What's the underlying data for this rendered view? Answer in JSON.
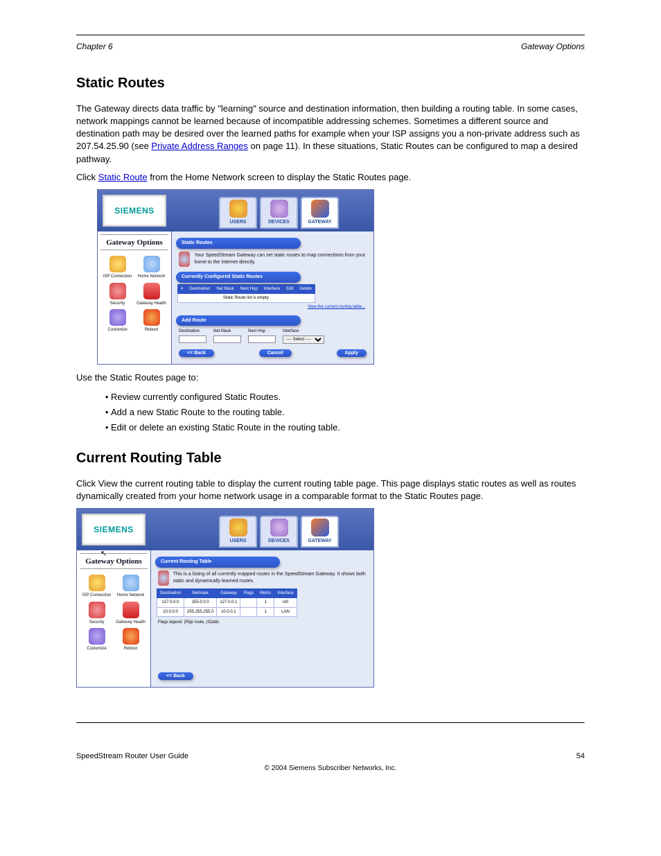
{
  "header": {
    "chapter": "Chapter 6",
    "section": "Gateway Options"
  },
  "body": {
    "h1_static": "Static Routes",
    "p1a": "The Gateway directs data traffic by \"learning\" source and destination information, then building a routing table. In some cases, network mappings cannot be learned because of incompatible addressing schemes. Sometimes a different source and destination path may be desired over the learned paths for example when your ISP assigns you a non-private address such as 207.54.25.90 (see ",
    "p1_link_text": "Private Address Ranges",
    "p1b": " on page 11). In these situations, Static Routes can be configured to map a desired pathway.",
    "p2a": "Click ",
    "p2_link_text": "Static Route",
    "p2b": " from the Home Network screen to display the Static Routes page.",
    "sr_intro": "Use the Static Routes page to:",
    "sr_bullets": [
      "Review currently configured Static Routes.",
      "Add a new Static Route to the routing table.",
      "Edit or delete an existing Static Route in the routing table."
    ],
    "h1_current": "Current Routing Table",
    "cr_p": "Click View the current routing table to display the current routing table page. This page displays static routes as well as routes dynamically created from your home network usage in a comparable format to the Static Routes page."
  },
  "shot_common": {
    "brand": "SIEMENS",
    "tabs": [
      "USERS",
      "DEVICES",
      "GATEWAY"
    ],
    "sidebar_title": "Gateway Options",
    "sidebar_items": [
      {
        "label": "ISP Connection"
      },
      {
        "label": "Home Network"
      },
      {
        "label": "Security"
      },
      {
        "label": "Gateway Health"
      },
      {
        "label": "Customize"
      },
      {
        "label": "Reboot"
      }
    ]
  },
  "shot1": {
    "pill_static": "Static Routes",
    "desc": "Your SpeedStream Gateway can set static routes to map connections from your home to the Internet directly.",
    "pill_current": "Currently Configured Static Routes",
    "th": [
      "#",
      "Destination",
      "Net Mask",
      "Next Hop",
      "Interface",
      "Edit",
      "Delete"
    ],
    "empty_msg": "Static Route list is empty.",
    "link_view": "View the current routing table...",
    "pill_add": "Add Route",
    "add_labels": {
      "dest": "Destination",
      "mask": "Net Mask",
      "hop": "Next Hop",
      "iface": "Interface"
    },
    "select_placeholder": "---- Select ----",
    "back_btn": "<< Back",
    "cancel_btn": "Cancel",
    "apply_btn": "Apply"
  },
  "shot2": {
    "pill": "Current Routing Table",
    "desc": "This is a listing of all currently mapped routes in the SpeedStream Gateway. It shows both static and dynamically learned routes.",
    "th": [
      "Destination",
      "Netmask",
      "Gateway",
      "Flags",
      "Metric",
      "Interface"
    ],
    "rows": [
      [
        "127.0.0.0",
        "255.0.0.0",
        "127.0.0.1",
        "",
        "1",
        "lo0"
      ],
      [
        "10.0.0.0",
        "255.255.255.0",
        "10.0.0.1",
        "",
        "1",
        "LAN"
      ]
    ],
    "legend": "Flags legend: (R)ip route, (S)tatic",
    "back_btn": "<< Back"
  },
  "footer": {
    "left": "SpeedStream Router User Guide",
    "right": "54",
    "copyright": "© 2004 Siemens Subscriber Networks, Inc."
  }
}
